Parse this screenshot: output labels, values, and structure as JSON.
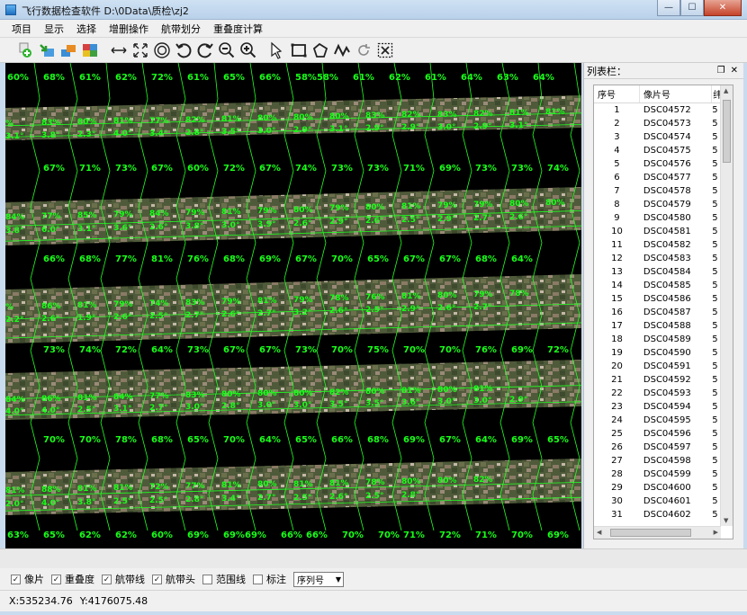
{
  "window": {
    "title": "飞行数据检查软件    D:\\0Data\\质检\\zj2"
  },
  "window_controls": {
    "minimize": "—",
    "maximize": "☐",
    "close": "✕"
  },
  "menu": [
    {
      "label": "项目"
    },
    {
      "label": "显示"
    },
    {
      "label": "选择"
    },
    {
      "label": "增删操作"
    },
    {
      "label": "航带划分"
    },
    {
      "label": "重叠度计算"
    }
  ],
  "toolbar": [
    "add-layer-icon",
    "import-icon",
    "layers-icon",
    "color-layers-icon",
    "measure-distance-icon",
    "full-extent-icon",
    "target-icon",
    "rotate-left-icon",
    "rotate-right-icon",
    "zoom-out-icon",
    "zoom-in-icon",
    "select-arrow-icon",
    "rectangle-select-icon",
    "polygon-select-icon",
    "line-select-icon",
    "refresh-icon",
    "clear-selection-icon"
  ],
  "colors": {
    "grid": "#22ff22",
    "label": "#19ff19",
    "background": "#000000"
  },
  "map_labels": [
    {
      "t": "60%",
      "r": 0,
      "c": 0
    },
    {
      "t": "68%",
      "r": 0,
      "c": 1
    },
    {
      "t": "61%",
      "r": 0,
      "c": 2
    },
    {
      "t": "62%",
      "r": 0,
      "c": 3
    },
    {
      "t": "72%",
      "r": 0,
      "c": 4
    },
    {
      "t": "61%",
      "r": 0,
      "c": 5
    },
    {
      "t": "65%",
      "r": 0,
      "c": 6
    },
    {
      "t": "66%",
      "r": 0,
      "c": 7
    },
    {
      "t": "58%",
      "r": 0,
      "c": 8
    },
    {
      "t": "58%",
      "r": 0,
      "c": 8.6
    },
    {
      "t": "61%",
      "r": 0,
      "c": 9.6
    },
    {
      "t": "62%",
      "r": 0,
      "c": 10.6
    },
    {
      "t": "61%",
      "r": 0,
      "c": 11.6
    },
    {
      "t": "64%",
      "r": 0,
      "c": 12.6
    },
    {
      "t": "63%",
      "r": 0,
      "c": 13.6
    },
    {
      "t": "64%",
      "r": 0,
      "c": 14.6
    },
    {
      "t": "67%",
      "r": 2,
      "c": 1
    },
    {
      "t": "71%",
      "r": 2,
      "c": 2
    },
    {
      "t": "73%",
      "r": 2,
      "c": 3
    },
    {
      "t": "67%",
      "r": 2,
      "c": 4
    },
    {
      "t": "60%",
      "r": 2,
      "c": 5
    },
    {
      "t": "72%",
      "r": 2,
      "c": 6
    },
    {
      "t": "67%",
      "r": 2,
      "c": 7
    },
    {
      "t": "74%",
      "r": 2,
      "c": 8
    },
    {
      "t": "73%",
      "r": 2,
      "c": 9
    },
    {
      "t": "73%",
      "r": 2,
      "c": 10
    },
    {
      "t": "71%",
      "r": 2,
      "c": 11
    },
    {
      "t": "69%",
      "r": 2,
      "c": 12
    },
    {
      "t": "73%",
      "r": 2,
      "c": 13
    },
    {
      "t": "73%",
      "r": 2,
      "c": 14
    },
    {
      "t": "74%",
      "r": 2,
      "c": 15
    },
    {
      "t": "66%",
      "r": 4,
      "c": 1
    },
    {
      "t": "68%",
      "r": 4,
      "c": 2
    },
    {
      "t": "77%",
      "r": 4,
      "c": 3
    },
    {
      "t": "81%",
      "r": 4,
      "c": 4
    },
    {
      "t": "76%",
      "r": 4,
      "c": 5
    },
    {
      "t": "68%",
      "r": 4,
      "c": 6
    },
    {
      "t": "69%",
      "r": 4,
      "c": 7
    },
    {
      "t": "67%",
      "r": 4,
      "c": 8
    },
    {
      "t": "70%",
      "r": 4,
      "c": 9
    },
    {
      "t": "65%",
      "r": 4,
      "c": 10
    },
    {
      "t": "67%",
      "r": 4,
      "c": 11
    },
    {
      "t": "67%",
      "r": 4,
      "c": 12
    },
    {
      "t": "68%",
      "r": 4,
      "c": 13
    },
    {
      "t": "64%",
      "r": 4,
      "c": 14
    },
    {
      "t": "73%",
      "r": 6,
      "c": 1
    },
    {
      "t": "74%",
      "r": 6,
      "c": 2
    },
    {
      "t": "72%",
      "r": 6,
      "c": 3
    },
    {
      "t": "64%",
      "r": 6,
      "c": 4
    },
    {
      "t": "73%",
      "r": 6,
      "c": 5
    },
    {
      "t": "67%",
      "r": 6,
      "c": 6
    },
    {
      "t": "67%",
      "r": 6,
      "c": 7
    },
    {
      "t": "73%",
      "r": 6,
      "c": 8
    },
    {
      "t": "70%",
      "r": 6,
      "c": 9
    },
    {
      "t": "75%",
      "r": 6,
      "c": 10
    },
    {
      "t": "70%",
      "r": 6,
      "c": 11
    },
    {
      "t": "70%",
      "r": 6,
      "c": 12
    },
    {
      "t": "76%",
      "r": 6,
      "c": 13
    },
    {
      "t": "69%",
      "r": 6,
      "c": 14
    },
    {
      "t": "72%",
      "r": 6,
      "c": 15
    },
    {
      "t": "70%",
      "r": 8,
      "c": 1
    },
    {
      "t": "70%",
      "r": 8,
      "c": 2
    },
    {
      "t": "78%",
      "r": 8,
      "c": 3
    },
    {
      "t": "68%",
      "r": 8,
      "c": 4
    },
    {
      "t": "65%",
      "r": 8,
      "c": 5
    },
    {
      "t": "70%",
      "r": 8,
      "c": 6
    },
    {
      "t": "64%",
      "r": 8,
      "c": 7
    },
    {
      "t": "65%",
      "r": 8,
      "c": 8
    },
    {
      "t": "66%",
      "r": 8,
      "c": 9
    },
    {
      "t": "68%",
      "r": 8,
      "c": 10
    },
    {
      "t": "69%",
      "r": 8,
      "c": 11
    },
    {
      "t": "67%",
      "r": 8,
      "c": 12
    },
    {
      "t": "64%",
      "r": 8,
      "c": 13
    },
    {
      "t": "69%",
      "r": 8,
      "c": 14
    },
    {
      "t": "65%",
      "r": 8,
      "c": 15
    },
    {
      "t": "63%",
      "r": 10,
      "c": 0
    },
    {
      "t": "65%",
      "r": 10,
      "c": 1
    },
    {
      "t": "62%",
      "r": 10,
      "c": 2
    },
    {
      "t": "62%",
      "r": 10,
      "c": 3
    },
    {
      "t": "60%",
      "r": 10,
      "c": 4
    },
    {
      "t": "69%",
      "r": 10,
      "c": 5
    },
    {
      "t": "69%",
      "r": 10,
      "c": 6
    },
    {
      "t": "69%",
      "r": 10,
      "c": 6.6
    },
    {
      "t": "66%",
      "r": 10,
      "c": 7.6
    },
    {
      "t": "66%",
      "r": 10,
      "c": 8.3
    },
    {
      "t": "70%",
      "r": 10,
      "c": 9.3
    },
    {
      "t": "70%",
      "r": 10,
      "c": 10.3
    },
    {
      "t": "71%",
      "r": 10,
      "c": 11
    },
    {
      "t": "72%",
      "r": 10,
      "c": 12
    },
    {
      "t": "71%",
      "r": 10,
      "c": 13
    },
    {
      "t": "70%",
      "r": 10,
      "c": 14
    },
    {
      "t": "69%",
      "r": 10,
      "c": 15
    }
  ],
  "strip_labels": [
    [
      "%",
      "83%",
      "80%",
      "81%",
      "77%",
      "82%",
      "81%",
      "80%",
      "80%",
      "80%",
      "83%",
      "82%",
      "83%",
      "82%",
      "81%",
      "81%"
    ],
    [
      "3.1°",
      "3.8°",
      "2.3°",
      "4.0°",
      "3.4°",
      "2.8°",
      "3.5°",
      "3.0°",
      "2.9°",
      "3.1°",
      "2.9°",
      "2.9°",
      "3.0°",
      "2.9°",
      "3.1°"
    ],
    [
      "84%",
      "77%",
      "85%",
      "79%",
      "84%",
      "79%",
      "81%",
      "79%",
      "80%",
      "79%",
      "80%",
      "81%",
      "79%",
      "79%",
      "80%",
      "80%"
    ],
    [
      "3.8°",
      "6.0°",
      "3.1°",
      "3.6°",
      "2.6°",
      "3.8°",
      "3.0°",
      "3.9°",
      "2.6°",
      "2.9°",
      "2.6°",
      "2.5°",
      "2.9°",
      "2.7°",
      "2.6°"
    ],
    [
      "%",
      "86%",
      "81%",
      "79%",
      "74%",
      "83%",
      "79%",
      "81%",
      "79%",
      "78%",
      "76%",
      "81%",
      "80%",
      "79%",
      "78%"
    ],
    [
      "2.2°",
      "2.6°",
      "1.9°",
      "2.6°",
      "2.5°",
      "2.7°",
      "2.6°",
      "2.7°",
      "3.2°",
      "2.6°",
      "2.5°",
      "2.9°",
      "2.6°",
      "2.7°"
    ],
    [
      "84%",
      "86%",
      "81%",
      "84%",
      "77%",
      "83%",
      "80%",
      "80%",
      "80%",
      "82%",
      "80%",
      "81%",
      "80%",
      "81%"
    ],
    [
      "4.0°",
      "4.0°",
      "2.5°",
      "3.1°",
      "2.7°",
      "3.0°",
      "2.8°",
      "3.0°",
      "3.0°",
      "3.5°",
      "3.5°",
      "3.6°",
      "3.0°",
      "3.0°",
      "2.9°"
    ],
    [
      "81%",
      "88%",
      "81%",
      "81%",
      "72%",
      "77%",
      "81%",
      "80%",
      "81%",
      "81%",
      "78%",
      "80%",
      "80%",
      "82%"
    ],
    [
      "2.0°",
      "4.0°",
      "3.8°",
      "2.5°",
      "2.5°",
      "2.8°",
      "3.4°",
      "2.7°",
      "2.5°",
      "2.6°",
      "2.5°",
      "2.8°"
    ]
  ],
  "panel": {
    "title": "列表栏：",
    "headers": [
      "序号",
      "像片号",
      "纬"
    ],
    "rows": [
      [
        "1",
        "DSC04572",
        "5"
      ],
      [
        "2",
        "DSC04573",
        "5"
      ],
      [
        "3",
        "DSC04574",
        "5"
      ],
      [
        "4",
        "DSC04575",
        "5"
      ],
      [
        "5",
        "DSC04576",
        "5"
      ],
      [
        "6",
        "DSC04577",
        "5"
      ],
      [
        "7",
        "DSC04578",
        "5"
      ],
      [
        "8",
        "DSC04579",
        "5"
      ],
      [
        "9",
        "DSC04580",
        "5"
      ],
      [
        "10",
        "DSC04581",
        "5"
      ],
      [
        "11",
        "DSC04582",
        "5"
      ],
      [
        "12",
        "DSC04583",
        "5"
      ],
      [
        "13",
        "DSC04584",
        "5"
      ],
      [
        "14",
        "DSC04585",
        "5"
      ],
      [
        "15",
        "DSC04586",
        "5"
      ],
      [
        "16",
        "DSC04587",
        "5"
      ],
      [
        "17",
        "DSC04588",
        "5"
      ],
      [
        "18",
        "DSC04589",
        "5"
      ],
      [
        "19",
        "DSC04590",
        "5"
      ],
      [
        "20",
        "DSC04591",
        "5"
      ],
      [
        "21",
        "DSC04592",
        "5"
      ],
      [
        "22",
        "DSC04593",
        "5"
      ],
      [
        "23",
        "DSC04594",
        "5"
      ],
      [
        "24",
        "DSC04595",
        "5"
      ],
      [
        "25",
        "DSC04596",
        "5"
      ],
      [
        "26",
        "DSC04597",
        "5"
      ],
      [
        "27",
        "DSC04598",
        "5"
      ],
      [
        "28",
        "DSC04599",
        "5"
      ],
      [
        "29",
        "DSC04600",
        "5"
      ],
      [
        "30",
        "DSC04601",
        "5"
      ],
      [
        "31",
        "DSC04602",
        "5"
      ]
    ]
  },
  "controls": {
    "checkboxes": [
      {
        "label": "像片",
        "checked": true
      },
      {
        "label": "重叠度",
        "checked": true
      },
      {
        "label": "航带线",
        "checked": true
      },
      {
        "label": "航带头",
        "checked": true
      },
      {
        "label": "范围线",
        "checked": false
      },
      {
        "label": "标注",
        "checked": false
      }
    ],
    "select_value": "序列号"
  },
  "status": {
    "x": "X:535234.76",
    "y": "Y:4176075.48"
  }
}
